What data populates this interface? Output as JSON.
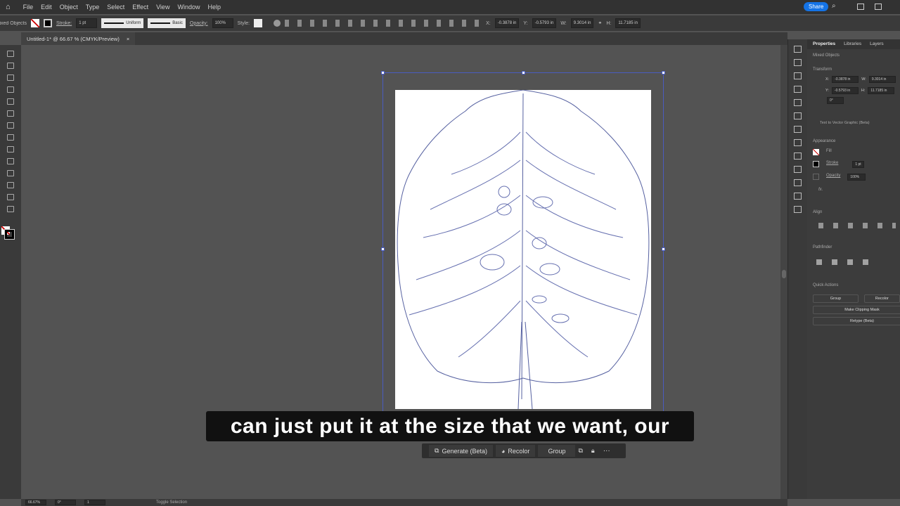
{
  "menu": [
    "File",
    "Edit",
    "Object",
    "Type",
    "Select",
    "Effect",
    "View",
    "Window",
    "Help"
  ],
  "share_label": "Share",
  "control": {
    "selection": "Mixed Objects",
    "stroke_label": "Stroke:",
    "stroke_value": "1 pt",
    "profile": "Uniform",
    "brush": "Basic",
    "opacity_label": "Opacity:",
    "opacity_value": "100%",
    "style_label": "Style:",
    "x_label": "X:",
    "x": "-0.3878 in",
    "y_label": "Y:",
    "y": "-0.5793 in",
    "w_label": "W:",
    "w": "9.3014 in",
    "h_label": "H:",
    "h": "11.7185 in"
  },
  "doc_tab": {
    "title": "Untitled-1* @ 66.67 % (CMYK/Preview)",
    "close": "×"
  },
  "panel": {
    "tabs": [
      "Properties",
      "Libraries",
      "Layers"
    ],
    "selection": "Mixed Objects",
    "transform": "Transform",
    "x_label": "X:",
    "x": "-0.3878 in",
    "y_label": "Y:",
    "y": "-0.5793 in",
    "w_label": "W:",
    "w": "9.3014 in",
    "h_label": "H:",
    "h": "11.7185 in",
    "angle": "0°",
    "text_to_vector": "Text to Vector Graphic (Beta)",
    "appearance": "Appearance",
    "fill": "Fill",
    "stroke": "Stroke",
    "stroke_value": "1 pt",
    "opacity": "Opacity",
    "opacity_value": "100%",
    "fx": "fx.",
    "align": "Align",
    "pathfinder": "Pathfinder",
    "quick_actions": "Quick Actions",
    "group": "Group",
    "recolor": "Recolor",
    "clipping": "Make Clipping Mask",
    "retype": "Retype (Beta)"
  },
  "caption": "can just put it at the size that we want, our",
  "context_bar": {
    "generate": "Generate (Beta)",
    "recolor": "Recolor",
    "group": "Group",
    "more": "···"
  },
  "status": {
    "zoom": "66.67%",
    "rotate": "0°",
    "artboard": "1",
    "toggle": "Toggle Selection"
  },
  "colors": {
    "selection": "#4a5cc0",
    "share": "#1473e6"
  }
}
